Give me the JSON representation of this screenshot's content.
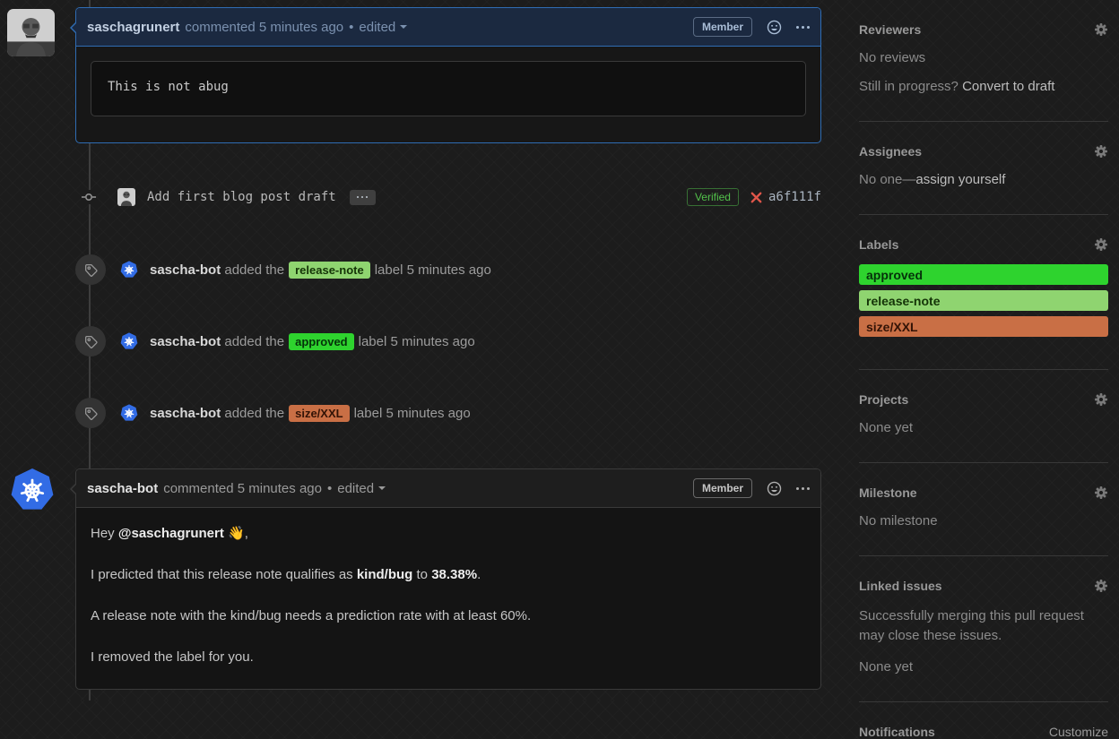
{
  "comment1": {
    "author": "saschagrunert",
    "meta": "commented 5 minutes ago",
    "separator": "•",
    "edited_label": "edited",
    "member_label": "Member",
    "code_body": "This is not abug"
  },
  "commit": {
    "message": "Add first blog post draft",
    "verified_label": "Verified",
    "hash": "a6f111f"
  },
  "label_events": [
    {
      "author": "sascha-bot",
      "action": "added the",
      "label": "release-note",
      "rest": "label 5 minutes ago"
    },
    {
      "author": "sascha-bot",
      "action": "added the",
      "label": "approved",
      "rest": "label 5 minutes ago"
    },
    {
      "author": "sascha-bot",
      "action": "added the",
      "label": "size/XXL",
      "rest": "label 5 minutes ago"
    }
  ],
  "comment2": {
    "author": "sascha-bot",
    "meta": "commented 5 minutes ago",
    "separator": "•",
    "edited_label": "edited",
    "member_label": "Member",
    "paragraphs": [
      [
        {
          "t": "Hey "
        },
        {
          "t": "@saschagrunert",
          "link": true
        },
        {
          "t": " "
        },
        {
          "t": "👋",
          "emoji": true
        },
        {
          "t": ","
        }
      ],
      [
        {
          "t": "I predicted that this release note qualifies as "
        },
        {
          "t": "kind/bug",
          "b": true
        },
        {
          "t": " to "
        },
        {
          "t": "38.38%",
          "b": true
        },
        {
          "t": "."
        }
      ],
      [
        {
          "t": "A release note with the kind/bug needs a prediction rate with at least 60%."
        }
      ],
      [
        {
          "t": "I removed the label for you."
        }
      ]
    ]
  },
  "sidebar": {
    "reviewers": {
      "title": "Reviewers",
      "empty": "No reviews",
      "hint": "Still in progress?",
      "link": "Convert to draft"
    },
    "assignees": {
      "title": "Assignees",
      "empty_prefix": "No one—",
      "link": "assign yourself"
    },
    "labels": {
      "title": "Labels",
      "items": [
        {
          "name": "approved"
        },
        {
          "name": "release-note"
        },
        {
          "name": "size/XXL"
        }
      ]
    },
    "projects": {
      "title": "Projects",
      "empty": "None yet"
    },
    "milestone": {
      "title": "Milestone",
      "empty": "No milestone"
    },
    "linked_issues": {
      "title": "Linked issues",
      "desc": "Successfully merging this pull request may close these issues.",
      "empty": "None yet"
    },
    "notifications": {
      "title": "Notifications",
      "link": "Customize"
    }
  },
  "colors": {
    "approved_bg": "#2ed32e",
    "approved_fg": "#05320a",
    "release_note_bg": "#8fd470",
    "release_note_fg": "#143307",
    "size_xxl_bg": "#c96f45",
    "size_xxl_fg": "#331306",
    "verified_green": "#52c24b",
    "failed_x_red": "#e0564a",
    "highlight_border": "#2f6cb3",
    "k8s_blue": "#326ce5"
  }
}
